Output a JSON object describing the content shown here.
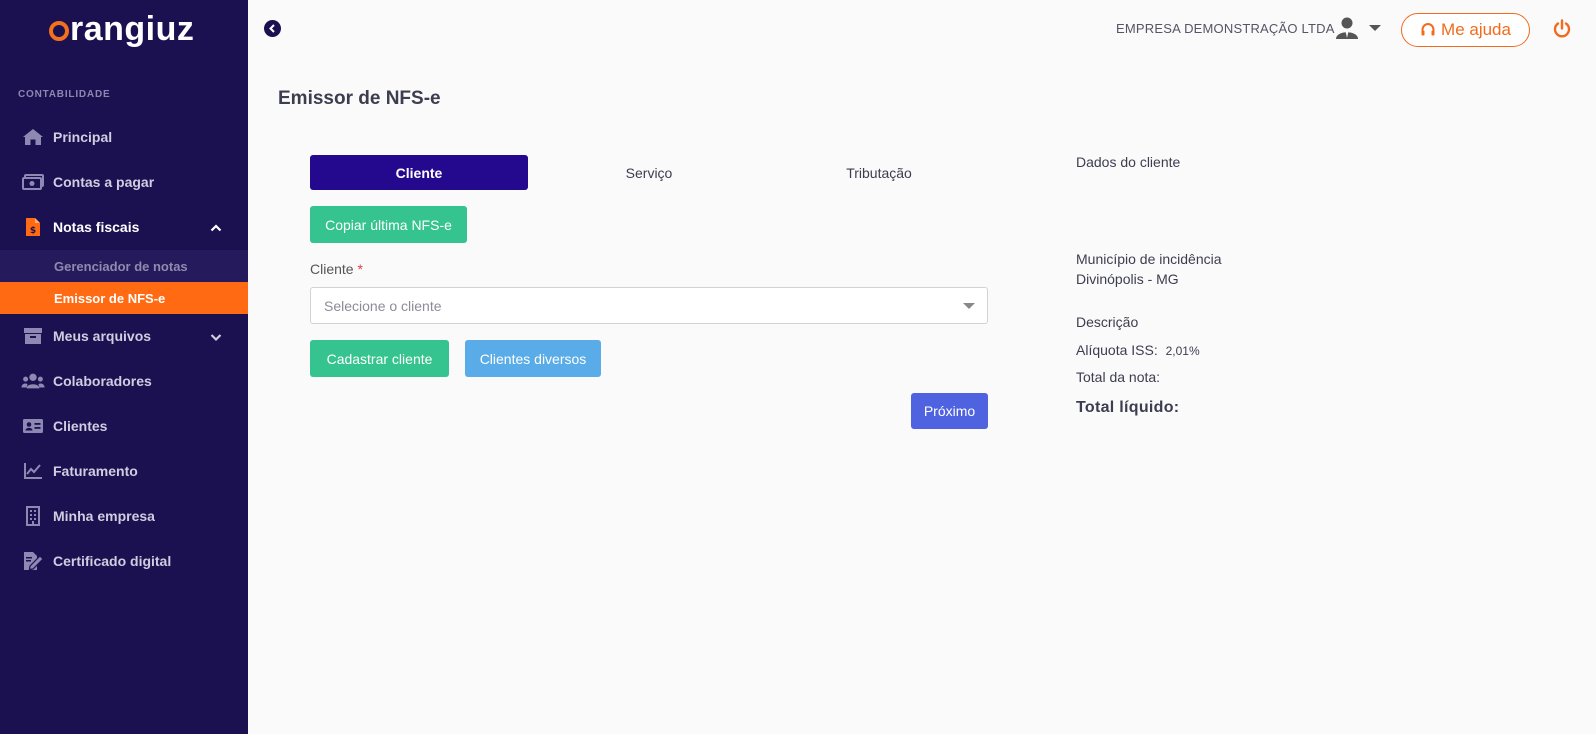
{
  "app": {
    "logo": "rangiuz",
    "logo_letter_icon": "o-circle"
  },
  "sidebar": {
    "section": "CONTABILIDADE",
    "items": [
      {
        "label": "Principal",
        "icon": "home-icon"
      },
      {
        "label": "Contas a pagar",
        "icon": "money-icon"
      },
      {
        "label": "Notas fiscais",
        "icon": "invoice-icon",
        "expanded": true
      },
      {
        "label": "Meus arquivos",
        "icon": "archive-icon"
      },
      {
        "label": "Colaboradores",
        "icon": "users-icon"
      },
      {
        "label": "Clientes",
        "icon": "id-card-icon"
      },
      {
        "label": "Faturamento",
        "icon": "chart-line-icon"
      },
      {
        "label": "Minha empresa",
        "icon": "building-icon"
      },
      {
        "label": "Certificado digital",
        "icon": "certificate-icon"
      }
    ],
    "subitems": [
      {
        "label": "Gerenciador de notas"
      },
      {
        "label": "Emissor de NFS-e",
        "active": true
      }
    ]
  },
  "header": {
    "company": "EMPRESA DEMONSTRAÇÃO LTDA",
    "help_label": "Me ajuda"
  },
  "page": {
    "title": "Emissor de NFS-e"
  },
  "steps": [
    {
      "label": "Cliente",
      "active": true
    },
    {
      "label": "Serviço"
    },
    {
      "label": "Tributação"
    }
  ],
  "form": {
    "copy_button": "Copiar última NFS-e",
    "client_label": "Cliente",
    "required_mark": "*",
    "client_placeholder": "Selecione o cliente",
    "register_button": "Cadastrar cliente",
    "various_button": "Clientes diversos",
    "next_button": "Próximo"
  },
  "summary": {
    "heading": "Dados do cliente",
    "municipio_label": "Município de incidência",
    "municipio_value": "Divinópolis - MG",
    "descricao_label": "Descrição",
    "aliquota_label": "Alíquota ISS:",
    "aliquota_value": "2,01%",
    "total_label": "Total da nota:",
    "liquido_label": "Total líquido:"
  },
  "colors": {
    "sidebar": "#1c1150",
    "accent": "#ff6a13",
    "step_active": "#24098f",
    "green": "#35c38f",
    "blue": "#5aace8",
    "indigo": "#4f63e0"
  }
}
